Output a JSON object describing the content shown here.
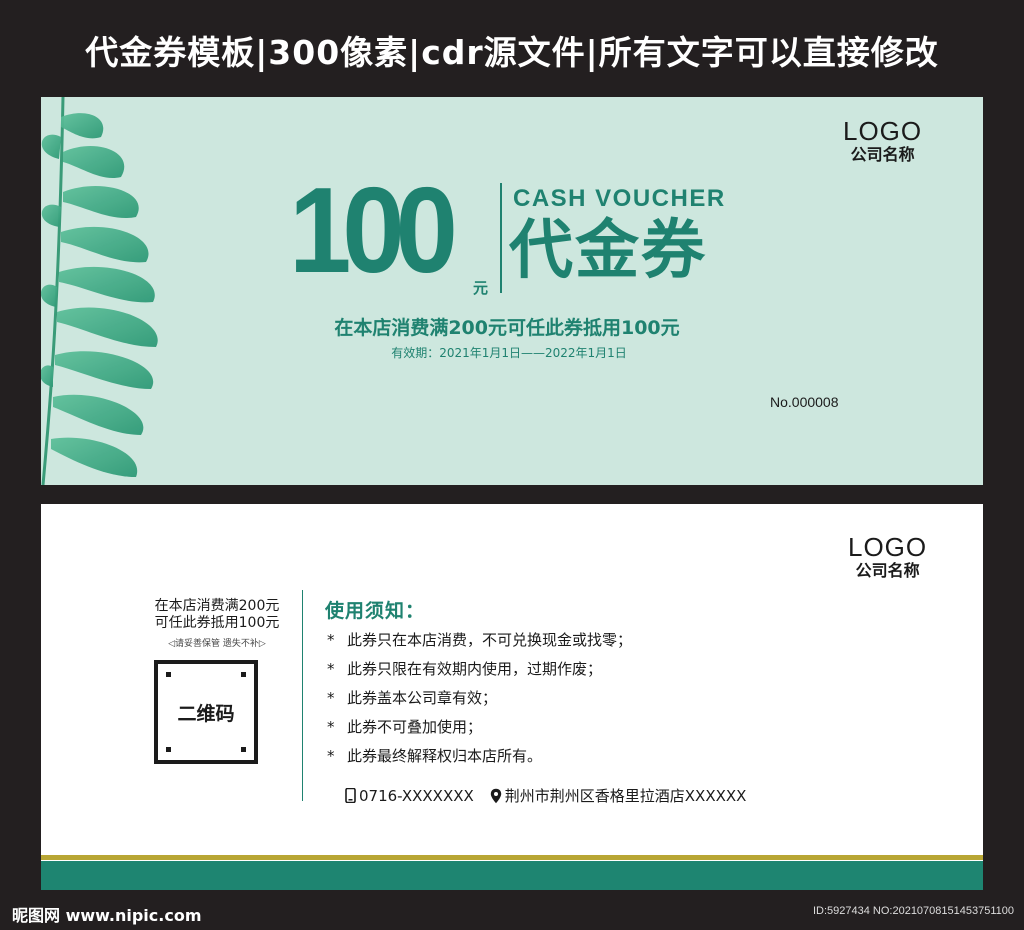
{
  "header": {
    "title": "代金券模板|300像素|cdr源文件|所有文字可以直接修改"
  },
  "front": {
    "logo": "LOGO",
    "company": "公司名称",
    "amount": "100",
    "amount_unit": "元",
    "cash_voucher": "CASH VOUCHER",
    "voucher_cn": "代金券",
    "condition": "在本店消费满200元可任此券抵用100元",
    "validity": "有效期：2021年1月1日——2022年1月1日",
    "serial": "No.000008",
    "colors": {
      "background": "#cde7de",
      "accent": "#1f8270"
    }
  },
  "back": {
    "logo": "LOGO",
    "company": "公司名称",
    "stub_line1": "在本店消费满200元",
    "stub_line2": "可任此券抵用100元",
    "stub_note": "◁请妥善保管  遗失不补▷",
    "qr_label": "二维码",
    "notice_title": "使用须知：",
    "rules": [
      "此券只在本店消费，不可兑换现金或找零；",
      "此券只限在有效期内使用，过期作废；",
      "此券盖本公司章有效；",
      "此券不可叠加使用；",
      "此券最终解释权归本店所有。"
    ],
    "rule_marker": "*",
    "phone": "0716-XXXXXXX",
    "address": "荆州市荆州区香格里拉酒店XXXXXX",
    "icons": {
      "phone": "phone-icon",
      "location": "location-pin-icon"
    },
    "colors": {
      "stripe_olive": "#b8a634",
      "stripe_teal": "#1e8571"
    }
  },
  "watermark": {
    "site": "昵图网 www.nipic.com",
    "id": "ID:5927434 NO:20210708151453751100"
  }
}
